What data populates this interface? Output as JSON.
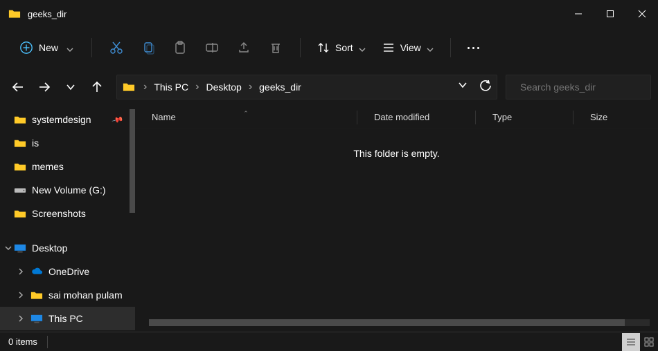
{
  "title": "geeks_dir",
  "toolbar": {
    "new_label": "New",
    "sort_label": "Sort",
    "view_label": "View"
  },
  "breadcrumbs": [
    "This PC",
    "Desktop",
    "geeks_dir"
  ],
  "search": {
    "placeholder": "Search geeks_dir"
  },
  "columns": {
    "name": "Name",
    "date": "Date modified",
    "type": "Type",
    "size": "Size"
  },
  "empty_message": "This folder is empty.",
  "sidebar": {
    "items": [
      {
        "label": "systemdesign",
        "icon": "folder",
        "pinned": true
      },
      {
        "label": "is",
        "icon": "folder"
      },
      {
        "label": "memes",
        "icon": "folder"
      },
      {
        "label": "New Volume (G:)",
        "icon": "drive"
      },
      {
        "label": "Screenshots",
        "icon": "folder"
      },
      {
        "label": "Desktop",
        "icon": "pc",
        "expand": "down"
      },
      {
        "label": "OneDrive",
        "icon": "cloud",
        "expand": "right",
        "indent": true
      },
      {
        "label": "sai mohan pulam",
        "icon": "folder",
        "expand": "right",
        "indent": true
      },
      {
        "label": "This PC",
        "icon": "pc",
        "expand": "right",
        "indent": true,
        "selected": true
      }
    ]
  },
  "status": {
    "count": "0 items"
  }
}
